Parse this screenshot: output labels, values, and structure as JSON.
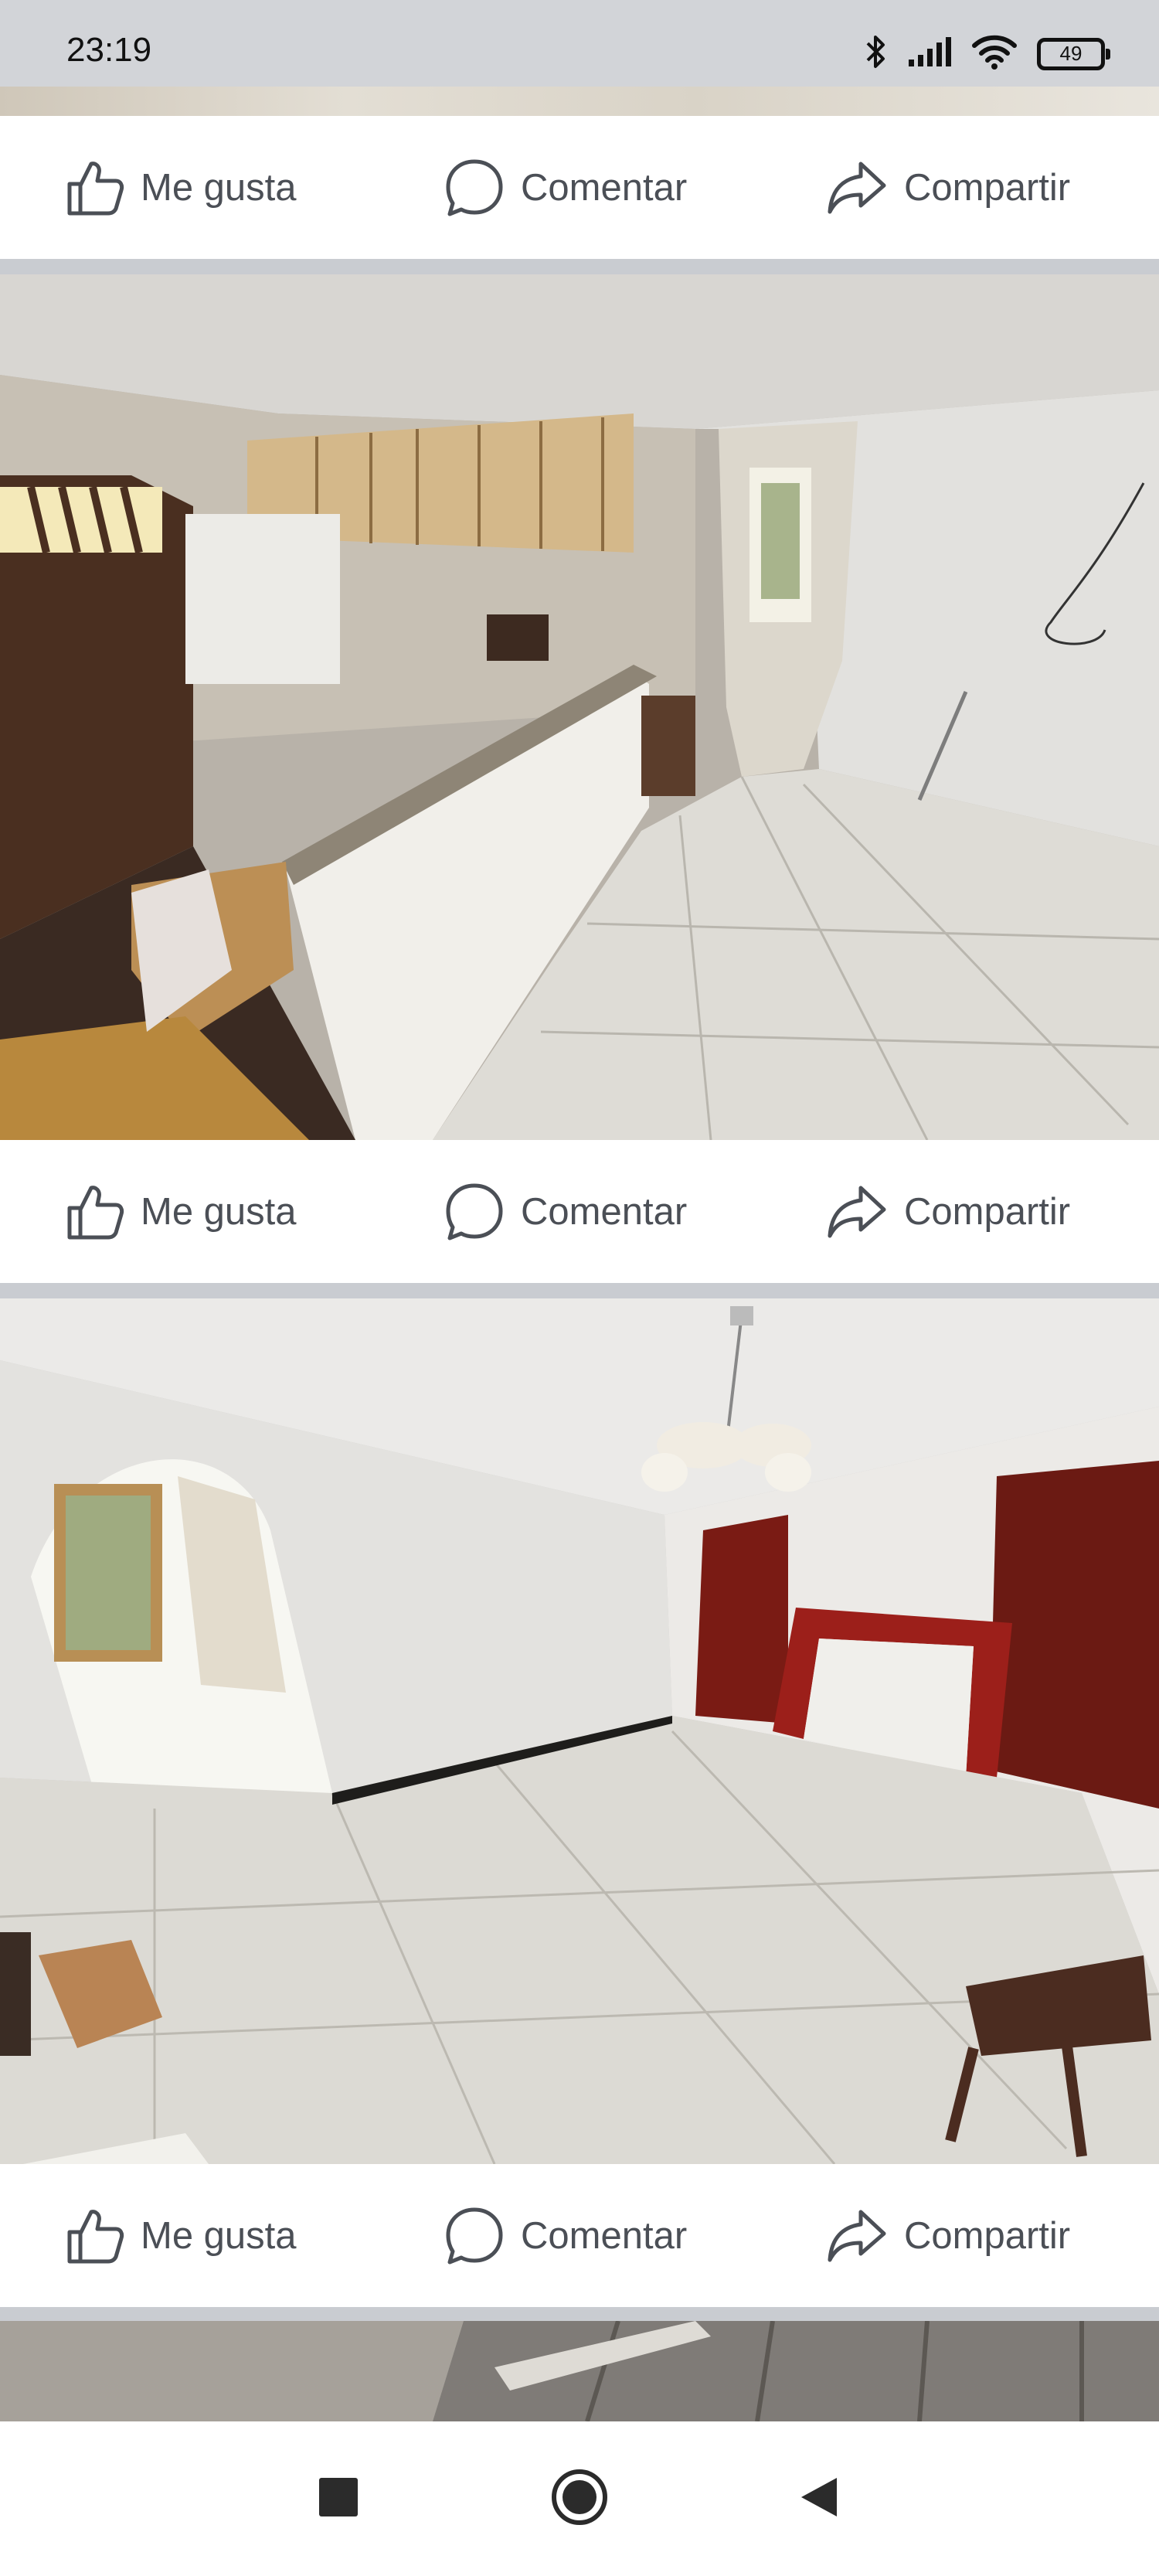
{
  "status_bar": {
    "time": "23:19",
    "battery_level": "49",
    "icons": [
      "bluetooth-icon",
      "signal-icon",
      "wifi-icon",
      "battery-icon"
    ]
  },
  "posts": [
    {
      "actions": {
        "like": "Me gusta",
        "comment": "Comentar",
        "share": "Compartir"
      }
    },
    {
      "actions": {
        "like": "Me gusta",
        "comment": "Comentar",
        "share": "Compartir"
      }
    },
    {
      "actions": {
        "like": "Me gusta",
        "comment": "Comentar",
        "share": "Compartir"
      }
    }
  ],
  "nav_bar": {
    "icons": [
      "recent-apps-icon",
      "home-icon",
      "back-icon"
    ]
  },
  "colors": {
    "status_bar_bg": "#d2d4d8",
    "separator": "#c9ccd1",
    "action_text": "#4b4f56",
    "nav_icon": "#2b2b2b"
  }
}
